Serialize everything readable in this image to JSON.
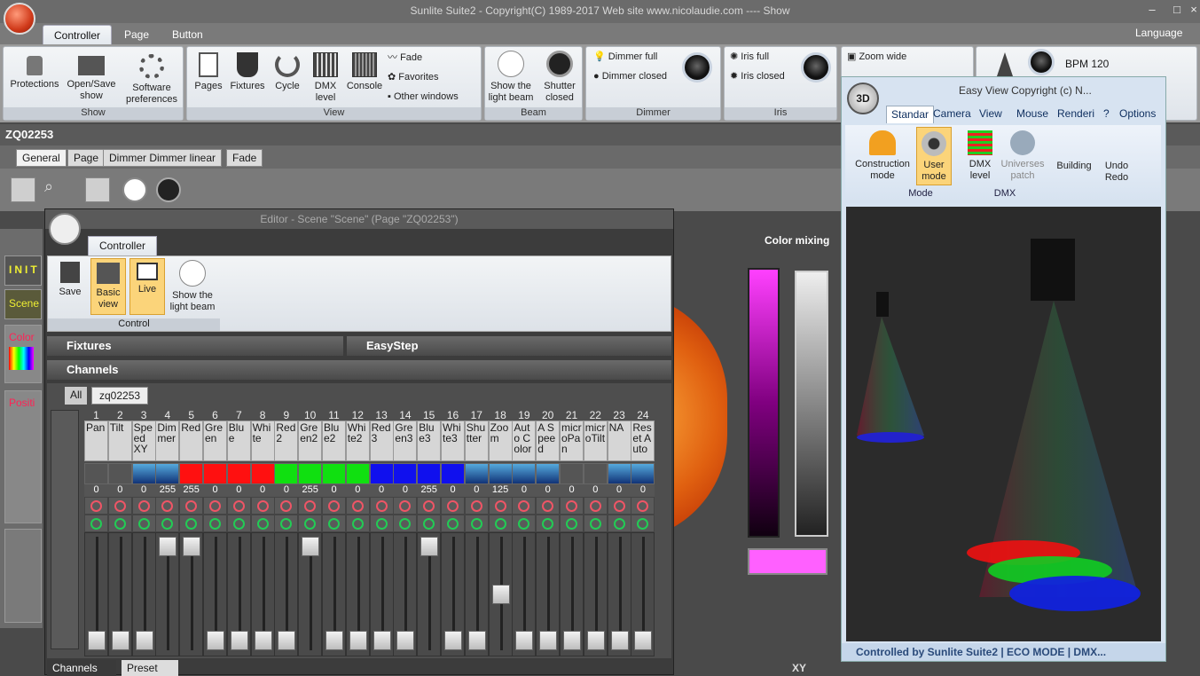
{
  "app": {
    "title": "Sunlite Suite2 - Copyright(C) 1989-2017    Web site www.nicolaudie.com ---- Show",
    "language": "Language"
  },
  "ribbon_tabs": [
    "Controller",
    "Page",
    "Button"
  ],
  "show_group": {
    "caption": "Show",
    "buttons": [
      "Protections",
      "Open/Save show",
      "Software preferences"
    ]
  },
  "view_group": {
    "caption": "View",
    "buttons": [
      "Pages",
      "Fixtures",
      "Cycle",
      "DMX level",
      "Console"
    ],
    "small": [
      "Fade",
      "Favorites",
      "Other windows"
    ]
  },
  "beam_group": {
    "caption": "Beam",
    "buttons": [
      "Show the light beam",
      "Shutter closed"
    ]
  },
  "dimmer_group": {
    "caption": "Dimmer",
    "items": [
      "Dimmer full",
      "Dimmer closed"
    ]
  },
  "iris_group": {
    "caption": "Iris",
    "items": [
      "Iris full",
      "Iris closed"
    ]
  },
  "zoom_group": {
    "items": [
      "Zoom wide"
    ],
    "bpm": "BPM 120"
  },
  "doc": {
    "title": "ZQ02253",
    "tabs": [
      "General",
      "Page",
      "Dimmer Dimmer linear",
      "Fade"
    ]
  },
  "left_labels": [
    "INIT",
    "Scene",
    "Color",
    "Positi"
  ],
  "color_mixing": "Color mixing",
  "xy_label": "XY",
  "editor": {
    "title": "Editor - Scene \"Scene\" (Page \"ZQ02253\")",
    "tab": "Controller",
    "buttons": [
      "Save",
      "Basic view",
      "Live",
      "Show the light beam"
    ],
    "caption": "Control",
    "sections": {
      "fixtures": "Fixtures",
      "easystep": "EasyStep",
      "channels": "Channels"
    },
    "chtabs": [
      "All",
      "zq02253"
    ],
    "bottom_tabs": [
      "Channels",
      "Preset"
    ]
  },
  "channels": [
    {
      "n": "1",
      "name": "Pan",
      "color": "",
      "val": "0",
      "pos": 0
    },
    {
      "n": "2",
      "name": "Tilt",
      "color": "",
      "val": "0",
      "pos": 0
    },
    {
      "n": "3",
      "name": "Speed XY",
      "color": "icon",
      "val": "0",
      "pos": 0
    },
    {
      "n": "4",
      "name": "Dimmer",
      "color": "icon",
      "val": "255",
      "pos": 1
    },
    {
      "n": "5",
      "name": "Red",
      "color": "#ff1010",
      "val": "255",
      "pos": 1
    },
    {
      "n": "6",
      "name": "Green",
      "color": "#ff1010",
      "val": "0",
      "pos": 0
    },
    {
      "n": "7",
      "name": "Blue",
      "color": "#ff1010",
      "val": "0",
      "pos": 0
    },
    {
      "n": "8",
      "name": "White",
      "color": "#ff1010",
      "val": "0",
      "pos": 0
    },
    {
      "n": "9",
      "name": "Red2",
      "color": "#10e010",
      "val": "0",
      "pos": 0
    },
    {
      "n": "10",
      "name": "Green2",
      "color": "#10e010",
      "val": "255",
      "pos": 1
    },
    {
      "n": "11",
      "name": "Blue2",
      "color": "#10e010",
      "val": "0",
      "pos": 0
    },
    {
      "n": "12",
      "name": "White2",
      "color": "#10e010",
      "val": "0",
      "pos": 0
    },
    {
      "n": "13",
      "name": "Red3",
      "color": "#1010ee",
      "val": "0",
      "pos": 0
    },
    {
      "n": "14",
      "name": "Green3",
      "color": "#1010ee",
      "val": "0",
      "pos": 0
    },
    {
      "n": "15",
      "name": "Blue3",
      "color": "#1010ee",
      "val": "255",
      "pos": 1
    },
    {
      "n": "16",
      "name": "White3",
      "color": "#1010ee",
      "val": "0",
      "pos": 0
    },
    {
      "n": "17",
      "name": "Shutter",
      "color": "icon",
      "val": "0",
      "pos": 0
    },
    {
      "n": "18",
      "name": "Zoom",
      "color": "icon",
      "val": "125",
      "pos": 0.49
    },
    {
      "n": "19",
      "name": "Auto Color",
      "color": "icon",
      "val": "0",
      "pos": 0
    },
    {
      "n": "20",
      "name": "A Speed",
      "color": "icon",
      "val": "0",
      "pos": 0
    },
    {
      "n": "21",
      "name": "microPan",
      "color": "",
      "val": "0",
      "pos": 0
    },
    {
      "n": "22",
      "name": "microTilt",
      "color": "",
      "val": "0",
      "pos": 0
    },
    {
      "n": "23",
      "name": "NA",
      "color": "icon",
      "val": "0",
      "pos": 0
    },
    {
      "n": "24",
      "name": "Reset Auto",
      "color": "icon",
      "val": "0",
      "pos": 0
    }
  ],
  "win3d": {
    "title": "Easy View  Copyright (c) N...",
    "tabs": [
      "Standar",
      "Camera",
      "View",
      "Mouse",
      "Renderi",
      "?",
      "Options"
    ],
    "buttons": [
      "Construction mode",
      "User mode",
      "DMX level",
      "Universes patch",
      "Building",
      "Undo Redo"
    ],
    "captions": [
      "Mode",
      "DMX"
    ],
    "status": "Controlled by Sunlite Suite2  |  ECO MODE  |  DMX..."
  }
}
